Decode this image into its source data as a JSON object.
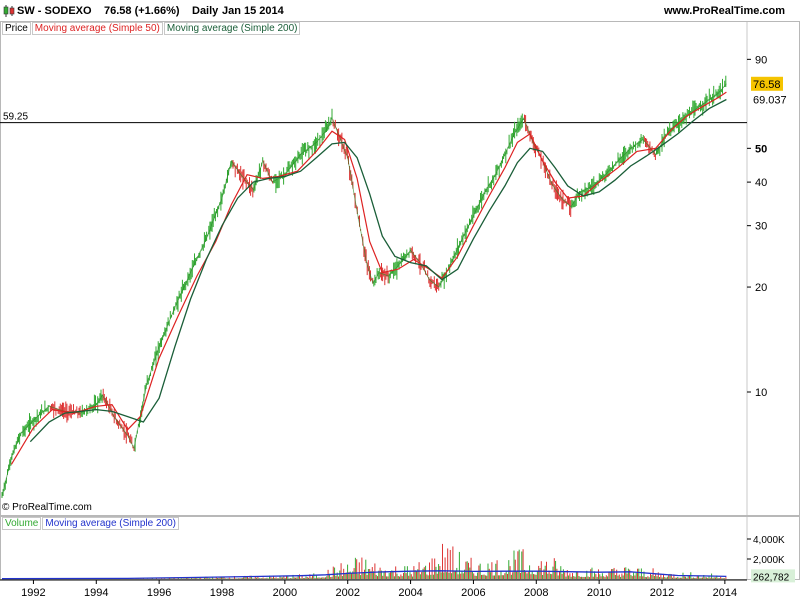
{
  "header": {
    "instrument": "SW - SODEXO",
    "last": "76.58 (+1.66%)",
    "period": "Daily",
    "date": "Jan 15 2014",
    "site": "www.ProRealTime.com"
  },
  "legend": {
    "price": "Price",
    "ma50": "Moving average (Simple 50)",
    "ma200": "Moving average (Simple 200)",
    "volume": "Volume",
    "vol_ma200": "Moving average (Simple 200)"
  },
  "copyright": "© ProRealTime.com",
  "colors": {
    "up": "#33aa33",
    "down": "#dd3333",
    "ma50": "#dd2222",
    "ma200": "#1a5e38",
    "vol_ma": "#2233cc",
    "last_tag": "#f5c400"
  },
  "chart_data": [
    {
      "type": "line",
      "scale": "log",
      "x_range": [
        1991.0,
        2014.1
      ],
      "ylim": [
        4.9,
        105
      ],
      "yticks": [
        {
          "value": 90,
          "label": "90"
        },
        {
          "value": 50,
          "label": "50"
        },
        {
          "value": 40,
          "label": "40"
        },
        {
          "value": 30,
          "label": "30"
        },
        {
          "value": 20,
          "label": "20"
        },
        {
          "value": 10,
          "label": "10"
        }
      ],
      "xticks": [
        {
          "value": 1992,
          "label": "1992"
        },
        {
          "value": 1994,
          "label": "1994"
        },
        {
          "value": 1996,
          "label": "1996"
        },
        {
          "value": 1998,
          "label": "1998"
        },
        {
          "value": 2000,
          "label": "2000"
        },
        {
          "value": 2002,
          "label": "2002"
        },
        {
          "value": 2004,
          "label": "2004"
        },
        {
          "value": 2006,
          "label": "2006"
        },
        {
          "value": 2008,
          "label": "2008"
        },
        {
          "value": 2010,
          "label": "2010"
        },
        {
          "value": 2012,
          "label": "2012"
        },
        {
          "value": 2014,
          "label": "2014"
        }
      ],
      "hline": {
        "value": 59.25,
        "label": "59.25"
      },
      "last_labels": [
        {
          "value": 76.58,
          "label": "76.58"
        },
        {
          "value": 69.037,
          "label": "69.037"
        }
      ],
      "series": [
        {
          "name": "Price",
          "x": [
            1991.0,
            1991.3,
            1991.6,
            1992.0,
            1992.5,
            1993.0,
            1993.5,
            1994.0,
            1994.2,
            1994.6,
            1995.0,
            1995.2,
            1995.6,
            1996.0,
            1996.5,
            1997.0,
            1997.5,
            1998.0,
            1998.3,
            1998.6,
            1999.0,
            1999.3,
            1999.6,
            2000.0,
            2000.5,
            2001.0,
            2001.3,
            2001.5,
            2001.7,
            2002.0,
            2002.3,
            2002.6,
            2002.8,
            2003.0,
            2003.3,
            2003.6,
            2004.0,
            2004.3,
            2004.6,
            2004.9,
            2005.2,
            2005.6,
            2006.0,
            2006.4,
            2006.7,
            2007.0,
            2007.3,
            2007.6,
            2007.9,
            2008.2,
            2008.5,
            2008.8,
            2009.1,
            2009.4,
            2009.8,
            2010.2,
            2010.6,
            2011.0,
            2011.4,
            2011.8,
            2012.2,
            2012.6,
            2013.0,
            2013.4,
            2013.8,
            2014.05
          ],
          "y": [
            5.0,
            6.5,
            7.6,
            8.3,
            9.1,
            8.8,
            8.7,
            9.2,
            9.8,
            8.4,
            7.5,
            6.9,
            10.5,
            13.5,
            17.5,
            22.0,
            27.5,
            36.0,
            46.0,
            42.0,
            38.0,
            46.0,
            40.0,
            42.0,
            48.0,
            52.0,
            56.0,
            61.0,
            55.0,
            47.0,
            33.0,
            23.5,
            20.5,
            22.0,
            21.5,
            23.0,
            25.5,
            23.5,
            21.0,
            20.0,
            22.5,
            27.0,
            32.0,
            38.0,
            42.0,
            48.0,
            55.0,
            61.0,
            52.0,
            46.0,
            39.5,
            36.0,
            34.0,
            37.5,
            39.0,
            42.0,
            46.0,
            50.0,
            53.0,
            48.0,
            56.0,
            60.0,
            64.0,
            68.0,
            72.0,
            76.58
          ]
        },
        {
          "name": "Moving average (Simple 50)",
          "x": [
            1991.3,
            1992.0,
            1992.6,
            1993.3,
            1994.0,
            1994.5,
            1995.0,
            1995.4,
            1996.0,
            1996.6,
            1997.2,
            1997.8,
            1998.3,
            1998.8,
            1999.3,
            1999.8,
            2000.4,
            2001.0,
            2001.5,
            2001.9,
            2002.3,
            2002.7,
            2003.1,
            2003.6,
            2004.1,
            2004.6,
            2005.0,
            2005.5,
            2006.0,
            2006.5,
            2007.0,
            2007.4,
            2007.8,
            2008.2,
            2008.6,
            2009.0,
            2009.5,
            2010.0,
            2010.6,
            2011.2,
            2011.8,
            2012.3,
            2012.8,
            2013.3,
            2013.8,
            2014.05
          ],
          "y": [
            6.2,
            7.9,
            8.9,
            8.7,
            9.1,
            9.2,
            7.8,
            8.5,
            12.5,
            16.5,
            21.5,
            27.0,
            34.5,
            42.0,
            41.0,
            41.5,
            43.0,
            49.0,
            56.0,
            53.0,
            41.0,
            27.0,
            22.0,
            22.5,
            24.0,
            22.5,
            21.2,
            24.5,
            30.0,
            36.5,
            44.0,
            52.0,
            55.0,
            46.0,
            40.0,
            36.0,
            36.5,
            40.0,
            44.0,
            49.0,
            50.0,
            56.5,
            62.0,
            66.0,
            70.0,
            72.5
          ]
        },
        {
          "name": "Moving average (Simple 200)",
          "x": [
            1991.9,
            1992.5,
            1993.0,
            1993.5,
            1994.0,
            1994.5,
            1995.0,
            1995.5,
            1996.0,
            1996.5,
            1997.0,
            1997.5,
            1998.0,
            1998.5,
            1999.0,
            1999.5,
            2000.0,
            2000.5,
            2001.0,
            2001.5,
            2001.9,
            2002.3,
            2002.7,
            2003.1,
            2003.5,
            2004.0,
            2004.5,
            2005.0,
            2005.5,
            2006.0,
            2006.5,
            2007.0,
            2007.4,
            2007.8,
            2008.2,
            2008.6,
            2009.0,
            2009.5,
            2010.0,
            2010.5,
            2011.0,
            2011.5,
            2012.0,
            2012.5,
            2013.0,
            2013.5,
            2014.05
          ],
          "y": [
            7.2,
            8.2,
            8.7,
            8.8,
            8.9,
            8.8,
            8.5,
            8.2,
            9.6,
            13.5,
            18.5,
            24.0,
            30.0,
            36.0,
            40.0,
            41.0,
            41.5,
            43.0,
            47.0,
            51.5,
            52.0,
            47.0,
            37.0,
            28.0,
            24.5,
            23.5,
            23.0,
            21.0,
            22.5,
            27.5,
            33.0,
            39.0,
            45.5,
            50.0,
            49.0,
            44.0,
            39.0,
            36.5,
            37.5,
            40.5,
            44.5,
            47.5,
            51.0,
            55.0,
            60.0,
            65.0,
            69.037
          ]
        }
      ]
    },
    {
      "type": "bar",
      "title": "Volume",
      "ylim": [
        0,
        4800
      ],
      "yticks": [
        {
          "value": 4000,
          "label": "4,000K"
        },
        {
          "value": 2000,
          "label": "2,000K"
        }
      ],
      "last_label": "262,782",
      "series": [
        {
          "name": "Volume",
          "x": [
            1992.0,
            1994.0,
            1996.0,
            1998.0,
            2000.0,
            2001.0,
            2001.5,
            2002.0,
            2002.5,
            2003.0,
            2004.0,
            2004.7,
            2005.0,
            2006.0,
            2007.0,
            2007.5,
            2008.0,
            2008.5,
            2009.0,
            2010.0,
            2011.0,
            2012.0,
            2013.0,
            2014.0
          ],
          "y": [
            30,
            50,
            120,
            300,
            400,
            600,
            1300,
            2100,
            2600,
            1800,
            1500,
            2600,
            4200,
            2000,
            2500,
            3200,
            2800,
            2400,
            1500,
            1200,
            1500,
            900,
            700,
            500
          ]
        },
        {
          "name": "Moving average (Simple 200)",
          "x": [
            1991.0,
            1995.0,
            1997.0,
            1999.0,
            2000.5,
            2001.3,
            2002.0,
            2003.0,
            2004.0,
            2005.0,
            2006.0,
            2007.0,
            2008.0,
            2009.0,
            2010.0,
            2011.0,
            2011.8,
            2012.5,
            2013.5,
            2014.05
          ],
          "y": [
            40,
            60,
            150,
            250,
            330,
            420,
            560,
            700,
            780,
            820,
            760,
            780,
            790,
            730,
            680,
            720,
            520,
            350,
            300,
            262.782
          ]
        }
      ]
    }
  ]
}
